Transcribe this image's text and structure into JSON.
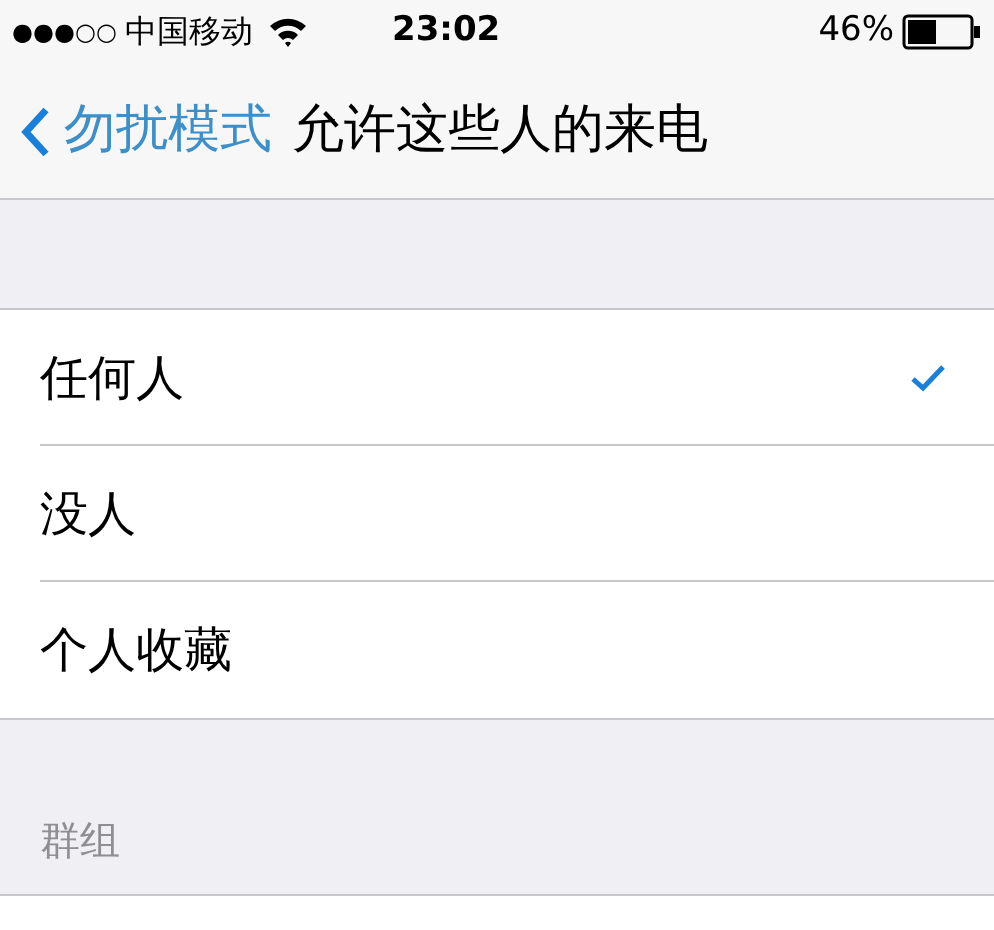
{
  "status_bar": {
    "signal_dots": [
      "●",
      "●",
      "●",
      "○",
      "○"
    ],
    "carrier": "中国移动",
    "time": "23:02",
    "battery_percent": "46%"
  },
  "nav_bar": {
    "back": "勿扰模式",
    "title": "允许这些人的来电"
  },
  "options": [
    {
      "label": "任何人",
      "selected": true
    },
    {
      "label": "没人",
      "selected": false
    },
    {
      "label": "个人收藏",
      "selected": false
    }
  ],
  "section_header": "群组"
}
